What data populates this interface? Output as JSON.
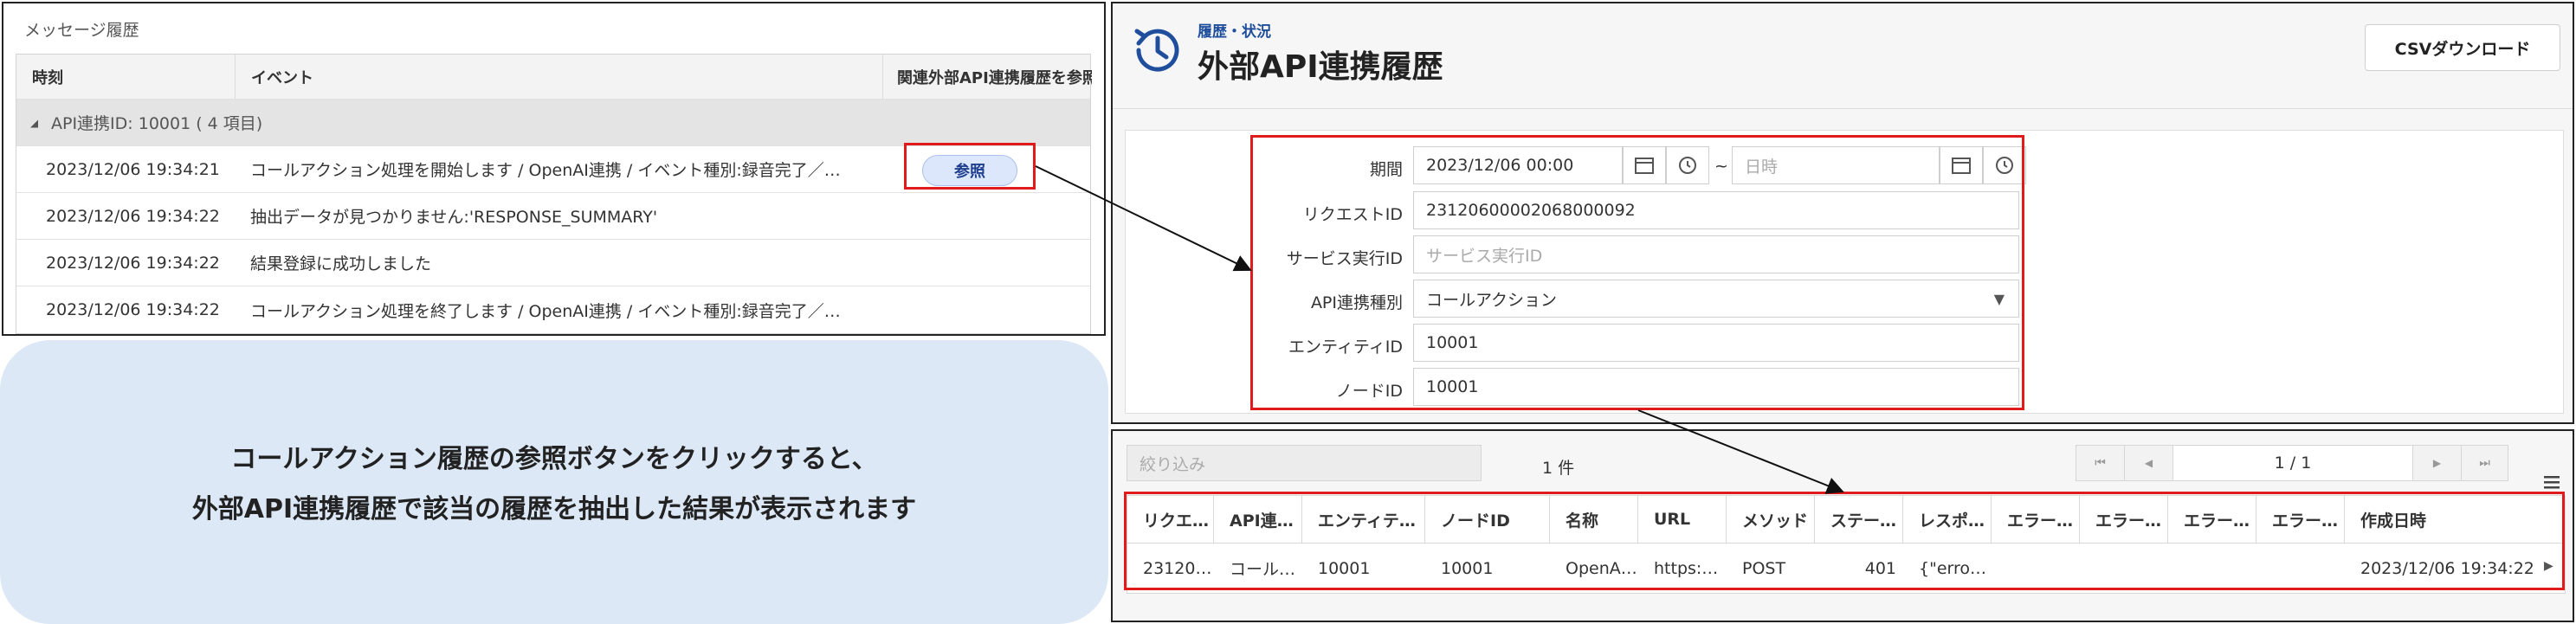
{
  "message_history": {
    "title": "メッセージ履歴",
    "columns": [
      "時刻",
      "イベント",
      "関連外部API連携履歴を参照"
    ],
    "group": {
      "collapse_icon": "◢",
      "label": "API連携ID: 10001 ( 4 項目)"
    },
    "rows": [
      {
        "time": "2023/12/06 19:34:21",
        "event": "コールアクション処理を開始します / OpenAI連携 / イベント種別:録音完了／…",
        "button": "参照"
      },
      {
        "time": "2023/12/06 19:34:22",
        "event": "抽出データが見つかりません:'RESPONSE_SUMMARY'"
      },
      {
        "time": "2023/12/06 19:34:22",
        "event": "結果登録に成功しました"
      },
      {
        "time": "2023/12/06 19:34:22",
        "event": "コールアクション処理を終了します / OpenAI連携 / イベント種別:録音完了／…"
      }
    ]
  },
  "callout": {
    "line1": "コールアクション履歴の参照ボタンをクリックすると、",
    "line2": "外部API連携履歴で該当の履歴を抽出した結果が表示されます"
  },
  "api_history": {
    "breadcrumb": "履歴・状況",
    "title": "外部API連携履歴",
    "csv_button": "CSVダウンロード",
    "form": {
      "period_label": "期間",
      "period_from": "2023/12/06 00:00",
      "period_separator": "~",
      "period_to_placeholder": "日時",
      "request_id_label": "リクエストID",
      "request_id": "23120600002068000092",
      "service_exec_label": "サービス実行ID",
      "service_exec_placeholder": "サービス実行ID",
      "api_type_label": "API連携種別",
      "api_type": "コールアクション",
      "entity_label": "エンティティID",
      "entity_id": "10001",
      "node_label": "ノードID",
      "node_id": "10001"
    }
  },
  "results": {
    "filter_placeholder": "絞り込み",
    "count": "1 件",
    "pagination": "1 / 1",
    "pager_icons": {
      "first": "⏮",
      "prev": "◀",
      "next": "▶",
      "last": "⏭"
    },
    "columns": [
      "リクエ…",
      "API連…",
      "エンティテ…",
      "ノードID",
      "名称",
      "URL",
      "メソッド",
      "ステー…",
      "レスポ…",
      "エラー…",
      "エラー…",
      "エラー…",
      "エラー…",
      "作成日時"
    ],
    "rows": [
      [
        "23120…",
        "コール…",
        "10001",
        "10001",
        "OpenA…",
        "https:…",
        "POST",
        "401",
        "{\"erro…",
        "",
        "",
        "",
        "",
        "2023/12/06 19:34:22"
      ]
    ]
  },
  "colors": {
    "highlight": "#e01b1b",
    "accent": "#1f4e9c",
    "callout_bg": "#dce8f5"
  }
}
